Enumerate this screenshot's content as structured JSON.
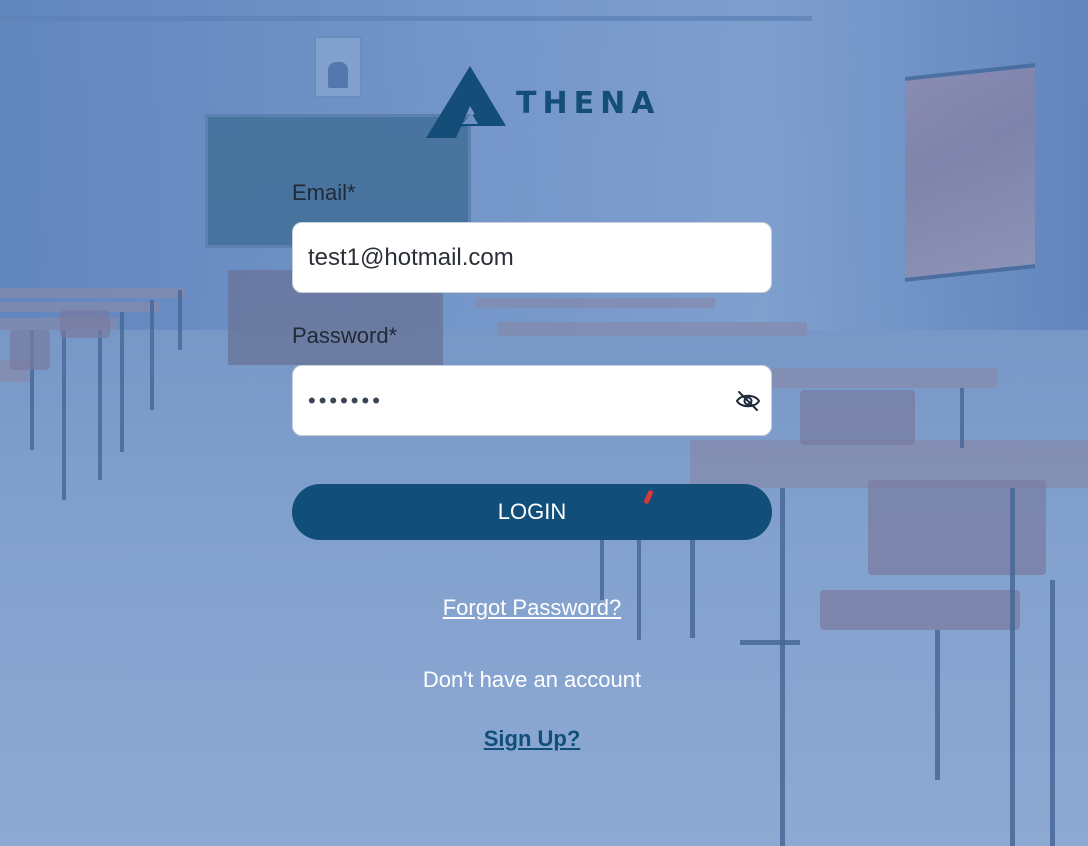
{
  "brand": {
    "name": "THENA",
    "logo_icon": "athena-a-logo-icon",
    "color": "#134d78"
  },
  "form": {
    "email": {
      "label": "Email*",
      "value": "test1@hotmail.com",
      "placeholder": ""
    },
    "password": {
      "label": "Password*",
      "value": "•••••••",
      "toggle_icon": "eye-off-icon"
    },
    "login_button": "LOGIN",
    "forgot_link": "Forgot Password?",
    "no_account_text": "Don't have an account",
    "signup_link": "Sign Up?"
  },
  "colors": {
    "primary": "#114e79",
    "background": "#6e90c4",
    "input_bg": "#ffffff"
  }
}
